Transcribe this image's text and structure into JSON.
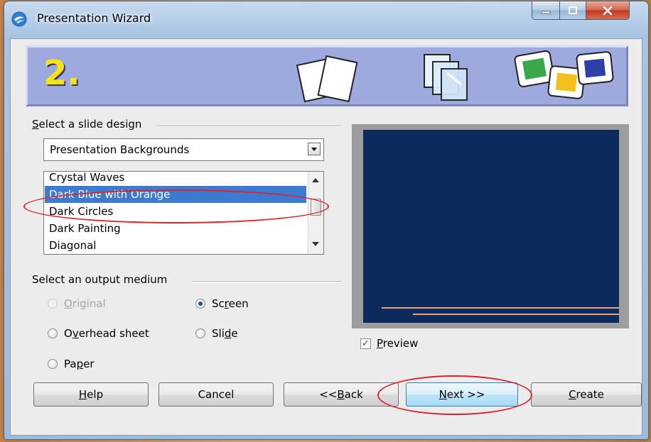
{
  "window": {
    "title": "Presentation Wizard"
  },
  "banner": {
    "step": "2."
  },
  "design_group": {
    "label_prefix": "",
    "label_hotkey": "S",
    "label_rest": "elect a slide design",
    "category": "Presentation Backgrounds",
    "items": [
      "Crystal Waves",
      "Dark Blue with Orange",
      "Dark Circles",
      "Dark Painting",
      "Diagonal"
    ],
    "selected": "Dark Blue with Orange"
  },
  "medium_group": {
    "label": "Select an output medium",
    "options": {
      "original": {
        "pre": "",
        "key": "O",
        "post": "riginal",
        "checked": false,
        "disabled": true
      },
      "overhead": {
        "pre": "O",
        "key": "v",
        "post": "erhead sheet",
        "checked": false,
        "disabled": false
      },
      "paper": {
        "pre": "Pa",
        "key": "p",
        "post": "er",
        "checked": false,
        "disabled": false
      },
      "screen": {
        "pre": "Sc",
        "key": "r",
        "post": "een",
        "checked": true,
        "disabled": false
      },
      "slide": {
        "pre": "Sli",
        "key": "d",
        "post": "e",
        "checked": false,
        "disabled": false
      }
    }
  },
  "preview": {
    "pre": "",
    "key": "P",
    "post": "review",
    "checked": true
  },
  "buttons": {
    "help": {
      "pre": "",
      "key": "H",
      "post": "elp"
    },
    "cancel": {
      "label": "Cancel"
    },
    "back": {
      "pre": "<< ",
      "key": "B",
      "post": "ack"
    },
    "next": {
      "pre": "",
      "key": "N",
      "post": "ext >>"
    },
    "create": {
      "pre": "",
      "key": "C",
      "post": "reate"
    }
  },
  "colors": {
    "banner": "#9ea9dd",
    "step_number": "#f6e21a",
    "selection": "#3d7bd1",
    "slide_background": "#0d2a5c",
    "slide_lines": "#e7a47a",
    "annotation": "#d7262b"
  },
  "icons": {
    "app": "presentation-wizard-icon",
    "checkmark": "✓"
  }
}
